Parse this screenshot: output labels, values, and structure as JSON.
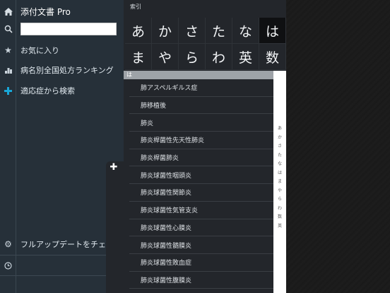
{
  "app": {
    "title": "添付文書 Pro"
  },
  "sidebar": {
    "search_placeholder": "",
    "items": [
      {
        "label": "お気に入り",
        "icon": "star-icon"
      },
      {
        "label": "病名別全国処方ランキング",
        "icon": "ranking-icon"
      },
      {
        "label": "適応症から検索",
        "icon": "plus-icon"
      }
    ],
    "update_label": "フルアップデートをチェック",
    "colors": {
      "accent": "#19a7d8",
      "background": "#263039"
    }
  },
  "index": {
    "header": "索引",
    "kana": [
      "あ",
      "か",
      "さ",
      "た",
      "な",
      "は",
      "ま",
      "や",
      "ら",
      "わ",
      "英",
      "数"
    ],
    "active": "は"
  },
  "list": {
    "section": "は",
    "items": [
      "肺アスペルギルス症",
      "肺移植後",
      "肺炎",
      "肺炎桿菌性先天性肺炎",
      "肺炎桿菌肺炎",
      "肺炎球菌性咽頭炎",
      "肺炎球菌性関節炎",
      "肺炎球菌性気管支炎",
      "肺炎球菌性心膜炎",
      "肺炎球菌性髄膜炎",
      "肺炎球菌性敗血症",
      "肺炎球菌性腹膜炎"
    ]
  },
  "side_index": [
    "あ",
    "か",
    "さ",
    "た",
    "な",
    "は",
    "ま",
    "や",
    "ら",
    "わ",
    "数",
    "英"
  ]
}
